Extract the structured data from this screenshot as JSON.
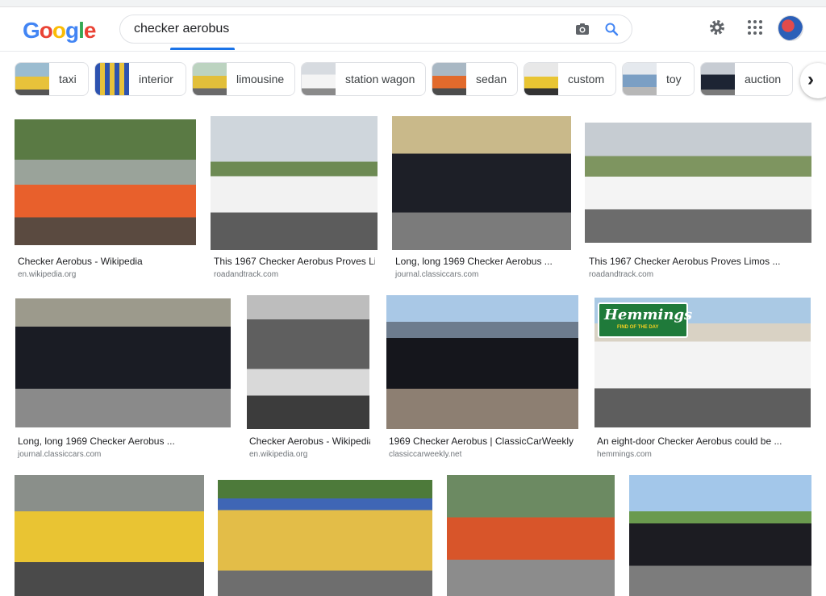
{
  "top_strip_text": "checker aerobus",
  "logo": [
    "G",
    "o",
    "o",
    "g",
    "l",
    "e"
  ],
  "search": {
    "value": "checker aerobus",
    "camera_icon": "camera-icon",
    "search_icon": "search-icon"
  },
  "header_icons": {
    "settings": "gear-icon",
    "apps": "apps-grid-icon",
    "account": "avatar"
  },
  "chips": [
    {
      "label": "taxi"
    },
    {
      "label": "interior"
    },
    {
      "label": "limousine"
    },
    {
      "label": "station wagon"
    },
    {
      "label": "sedan"
    },
    {
      "label": "custom"
    },
    {
      "label": "toy"
    },
    {
      "label": "auction"
    }
  ],
  "next_icon": "chevron-right-icon",
  "results": [
    {
      "title": "Checker Aerobus - Wikipedia",
      "source": "en.wikipedia.org",
      "color": "#e8602c"
    },
    {
      "title": "This 1967 Checker Aerobus Proves Li...",
      "source": "roadandtrack.com",
      "color": "#f2f2f2"
    },
    {
      "title": "Long, long 1969 Checker Aerobus ...",
      "source": "journal.classiccars.com",
      "color": "#1d1f27"
    },
    {
      "title": "This 1967 Checker Aerobus Proves Limos ...",
      "source": "roadandtrack.com",
      "color": "#f4f4f4"
    },
    {
      "title": "Long, long 1969 Checker Aerobus ...",
      "source": "journal.classiccars.com",
      "color": "#1a1c24"
    },
    {
      "title": "Checker Aerobus - Wikipedia",
      "source": "en.wikipedia.org",
      "color": "#8a8a8a"
    },
    {
      "title": "1969 Checker Aerobus | ClassicCarWeekly ...",
      "source": "classiccarweekly.net",
      "color": "#15161c"
    },
    {
      "title": "An eight-door Checker Aerobus could be ...",
      "source": "hemmings.com",
      "color": "#f3f3f3"
    },
    {
      "title": "",
      "source": "",
      "color": "#e9c433"
    },
    {
      "title": "",
      "source": "",
      "color": "#e3bd48"
    },
    {
      "title": "",
      "source": "",
      "color": "#d8552a"
    },
    {
      "title": "",
      "source": "",
      "color": "#1c1c22"
    }
  ],
  "hemmings_sign": {
    "title": "Hemmings",
    "sub": "FIND OF THE DAY"
  }
}
